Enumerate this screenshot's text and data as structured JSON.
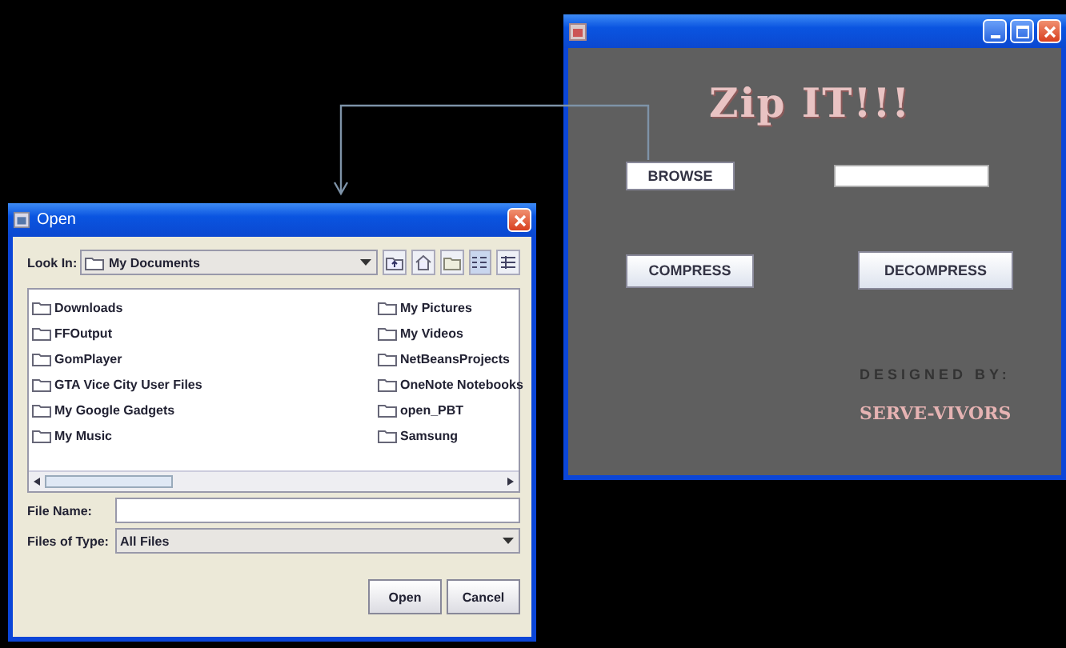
{
  "zip_window": {
    "heading": "Zip IT!!!",
    "browse_button": "BROWSE",
    "compress_button": "COMPRESS",
    "decompress_button": "DECOMPRESS",
    "credit_label": "DESIGNED BY:",
    "credit_name": "SERVE-VIVORS"
  },
  "open_dialog": {
    "title": "Open",
    "look_in_label": "Look In:",
    "look_in_value": "My Documents",
    "files": [
      "Downloads",
      "FFOutput",
      "GomPlayer",
      "GTA Vice City User Files",
      "My Google Gadgets",
      "My Music",
      "My Pictures",
      "My Videos",
      "NetBeansProjects",
      "OneNote Notebooks",
      "open_PBT",
      "Samsung"
    ],
    "file_name_label": "File Name:",
    "file_type_label": "Files of Type:",
    "file_type_value": "All Files",
    "buttons": [
      "Open",
      "Cancel"
    ]
  }
}
